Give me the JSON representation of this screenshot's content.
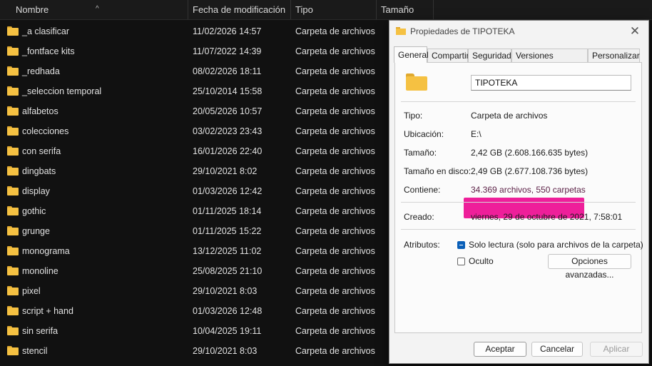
{
  "columns": {
    "name": "Nombre",
    "modified": "Fecha de modificación",
    "type": "Tipo",
    "size": "Tamaño"
  },
  "sort_indicator": "^",
  "rows": [
    {
      "name": "_a clasificar",
      "modified": "11/02/2026 14:57",
      "type": "Carpeta de archivos"
    },
    {
      "name": "_fontface kits",
      "modified": "11/07/2022 14:39",
      "type": "Carpeta de archivos"
    },
    {
      "name": "_redhada",
      "modified": "08/02/2026 18:11",
      "type": "Carpeta de archivos"
    },
    {
      "name": "_seleccion temporal",
      "modified": "25/10/2014 15:58",
      "type": "Carpeta de archivos"
    },
    {
      "name": "alfabetos",
      "modified": "20/05/2026 10:57",
      "type": "Carpeta de archivos"
    },
    {
      "name": "colecciones",
      "modified": "03/02/2023 23:43",
      "type": "Carpeta de archivos"
    },
    {
      "name": "con serifa",
      "modified": "16/01/2026 22:40",
      "type": "Carpeta de archivos"
    },
    {
      "name": "dingbats",
      "modified": "29/10/2021 8:02",
      "type": "Carpeta de archivos"
    },
    {
      "name": "display",
      "modified": "01/03/2026 12:42",
      "type": "Carpeta de archivos"
    },
    {
      "name": "gothic",
      "modified": "01/11/2025 18:14",
      "type": "Carpeta de archivos"
    },
    {
      "name": "grunge",
      "modified": "01/11/2025 15:22",
      "type": "Carpeta de archivos"
    },
    {
      "name": "monograma",
      "modified": "13/12/2025 11:02",
      "type": "Carpeta de archivos"
    },
    {
      "name": "monoline",
      "modified": "25/08/2025 21:10",
      "type": "Carpeta de archivos"
    },
    {
      "name": "pixel",
      "modified": "29/10/2021 8:03",
      "type": "Carpeta de archivos"
    },
    {
      "name": "script + hand",
      "modified": "01/03/2026 12:48",
      "type": "Carpeta de archivos"
    },
    {
      "name": "sin serifa",
      "modified": "10/04/2025 19:11",
      "type": "Carpeta de archivos"
    },
    {
      "name": "stencil",
      "modified": "29/10/2021 8:03",
      "type": "Carpeta de archivos"
    }
  ],
  "dialog": {
    "title": "Propiedades de TIPOTEKA",
    "close_glyph": "✕",
    "tabs": [
      "General",
      "Compartir",
      "Seguridad",
      "Versiones anteriores",
      "Personalizar"
    ],
    "active_tab": "General",
    "folder_name": "TIPOTEKA",
    "props": {
      "type_label": "Tipo:",
      "type_value": "Carpeta de archivos",
      "location_label": "Ubicación:",
      "location_value": "E:\\",
      "size_label": "Tamaño:",
      "size_value": "2,42 GB (2.608.166.635 bytes)",
      "disk_size_label": "Tamaño en disco:",
      "disk_size_value": "2,49 GB (2.677.108.736 bytes)",
      "contains_label": "Contiene:",
      "contains_value": "34.369 archivos, 550 carpetas",
      "created_label": "Creado:",
      "created_value": "viernes, 29 de octubre de 2021, 7:58:01",
      "attributes_label": "Atributos:"
    },
    "attributes": {
      "readonly_label": "Solo lectura (solo para archivos de la carpeta)",
      "readonly_state": "indeterminate",
      "hidden_label": "Oculto",
      "hidden_state": "unchecked",
      "advanced_button": "Opciones avanzadas..."
    },
    "buttons": {
      "accept": "Aceptar",
      "cancel": "Cancelar",
      "apply": "Aplicar"
    },
    "highlight_color": "#ee1f9a"
  }
}
